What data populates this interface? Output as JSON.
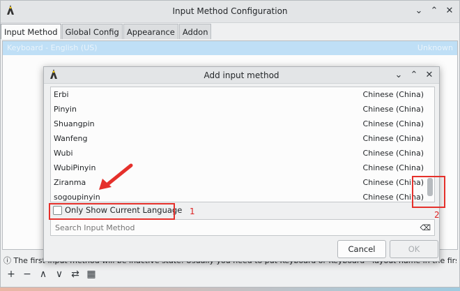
{
  "main": {
    "title": "Input Method Configuration",
    "tabs": [
      "Input Method",
      "Global Config",
      "Appearance",
      "Addon"
    ],
    "list_row": {
      "name": "Keyboard - English (US)",
      "status": "Unknown"
    },
    "hint": "ⓘ The first input method will be inactive state. Usually you need to put Keyboard or Keyboard - layout name in the first place.",
    "tool_icons": [
      "+",
      "−",
      "∧",
      "∨",
      "⇄",
      "▦"
    ]
  },
  "dialog": {
    "title": "Add input method",
    "items": [
      {
        "name": "Erbi",
        "lang": "Chinese (China)"
      },
      {
        "name": "Pinyin",
        "lang": "Chinese (China)"
      },
      {
        "name": "Shuangpin",
        "lang": "Chinese (China)"
      },
      {
        "name": "Wanfeng",
        "lang": "Chinese (China)"
      },
      {
        "name": "Wubi",
        "lang": "Chinese (China)"
      },
      {
        "name": "WubiPinyin",
        "lang": "Chinese (China)"
      },
      {
        "name": "Ziranma",
        "lang": "Chinese (China)"
      },
      {
        "name": "sogoupinyin",
        "lang": "Chinese (China)"
      }
    ],
    "checkbox_label": "Only Show Current Language",
    "search_placeholder": "Search Input Method",
    "cancel": "Cancel",
    "ok": "OK"
  },
  "annotations": {
    "label1": "1",
    "label2": "2",
    "color": "#e5302b"
  },
  "colors": {
    "selection": "#bfdff6",
    "accent": "#3daee9"
  }
}
